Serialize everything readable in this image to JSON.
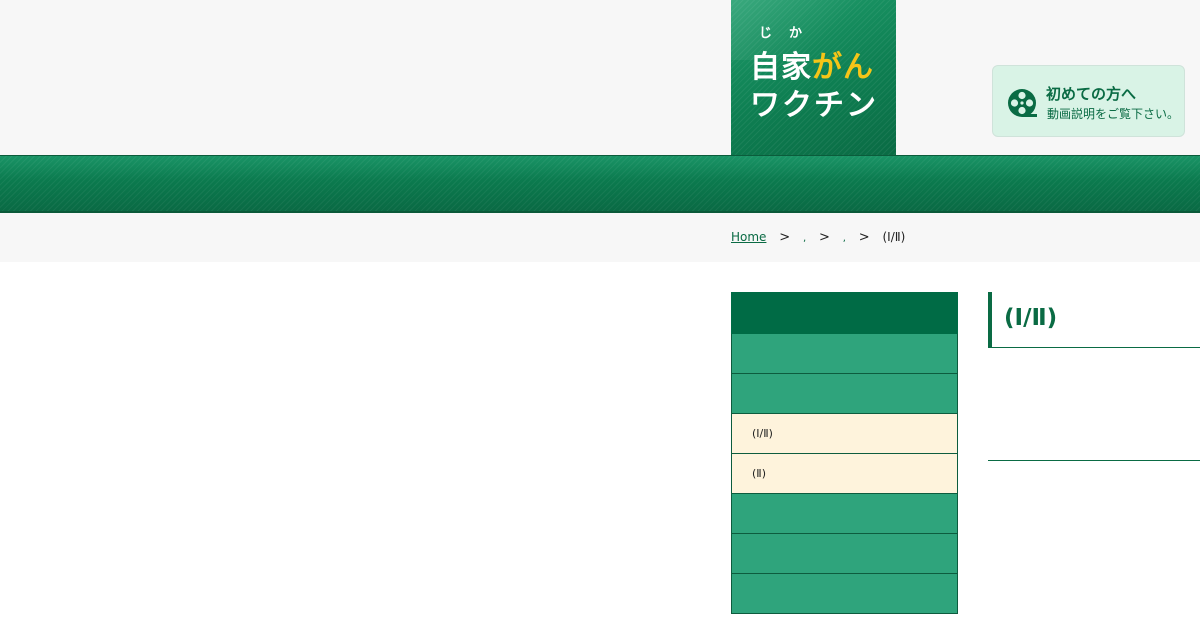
{
  "logo": {
    "furigana_1": "じ",
    "furigana_2": "か",
    "line1_part1": "自家",
    "line1_part2": "がん",
    "line2": "ワクチン"
  },
  "first_visit": {
    "title": "初めての方へ",
    "subtitle": "動画説明をご覧下さい。",
    "icon": "film-reel-icon"
  },
  "breadcrumb": {
    "home": "Home",
    "separator": ">",
    "crumb1": ",",
    "crumb2": ",",
    "current": "(Ⅰ/Ⅱ)"
  },
  "sidebar": {
    "items": [
      {
        "label": ""
      },
      {
        "label": ""
      },
      {
        "label": "(Ⅰ/Ⅱ)"
      },
      {
        "label": "(Ⅱ)"
      },
      {
        "label": ""
      },
      {
        "label": ""
      },
      {
        "label": ""
      }
    ]
  },
  "main": {
    "title": "(Ⅰ/Ⅱ)"
  },
  "colors": {
    "brand_green": "#0a6b44",
    "menu_green": "#2fa47c",
    "submenu_cream": "#fef3dc",
    "logo_yellow": "#f5c518"
  }
}
